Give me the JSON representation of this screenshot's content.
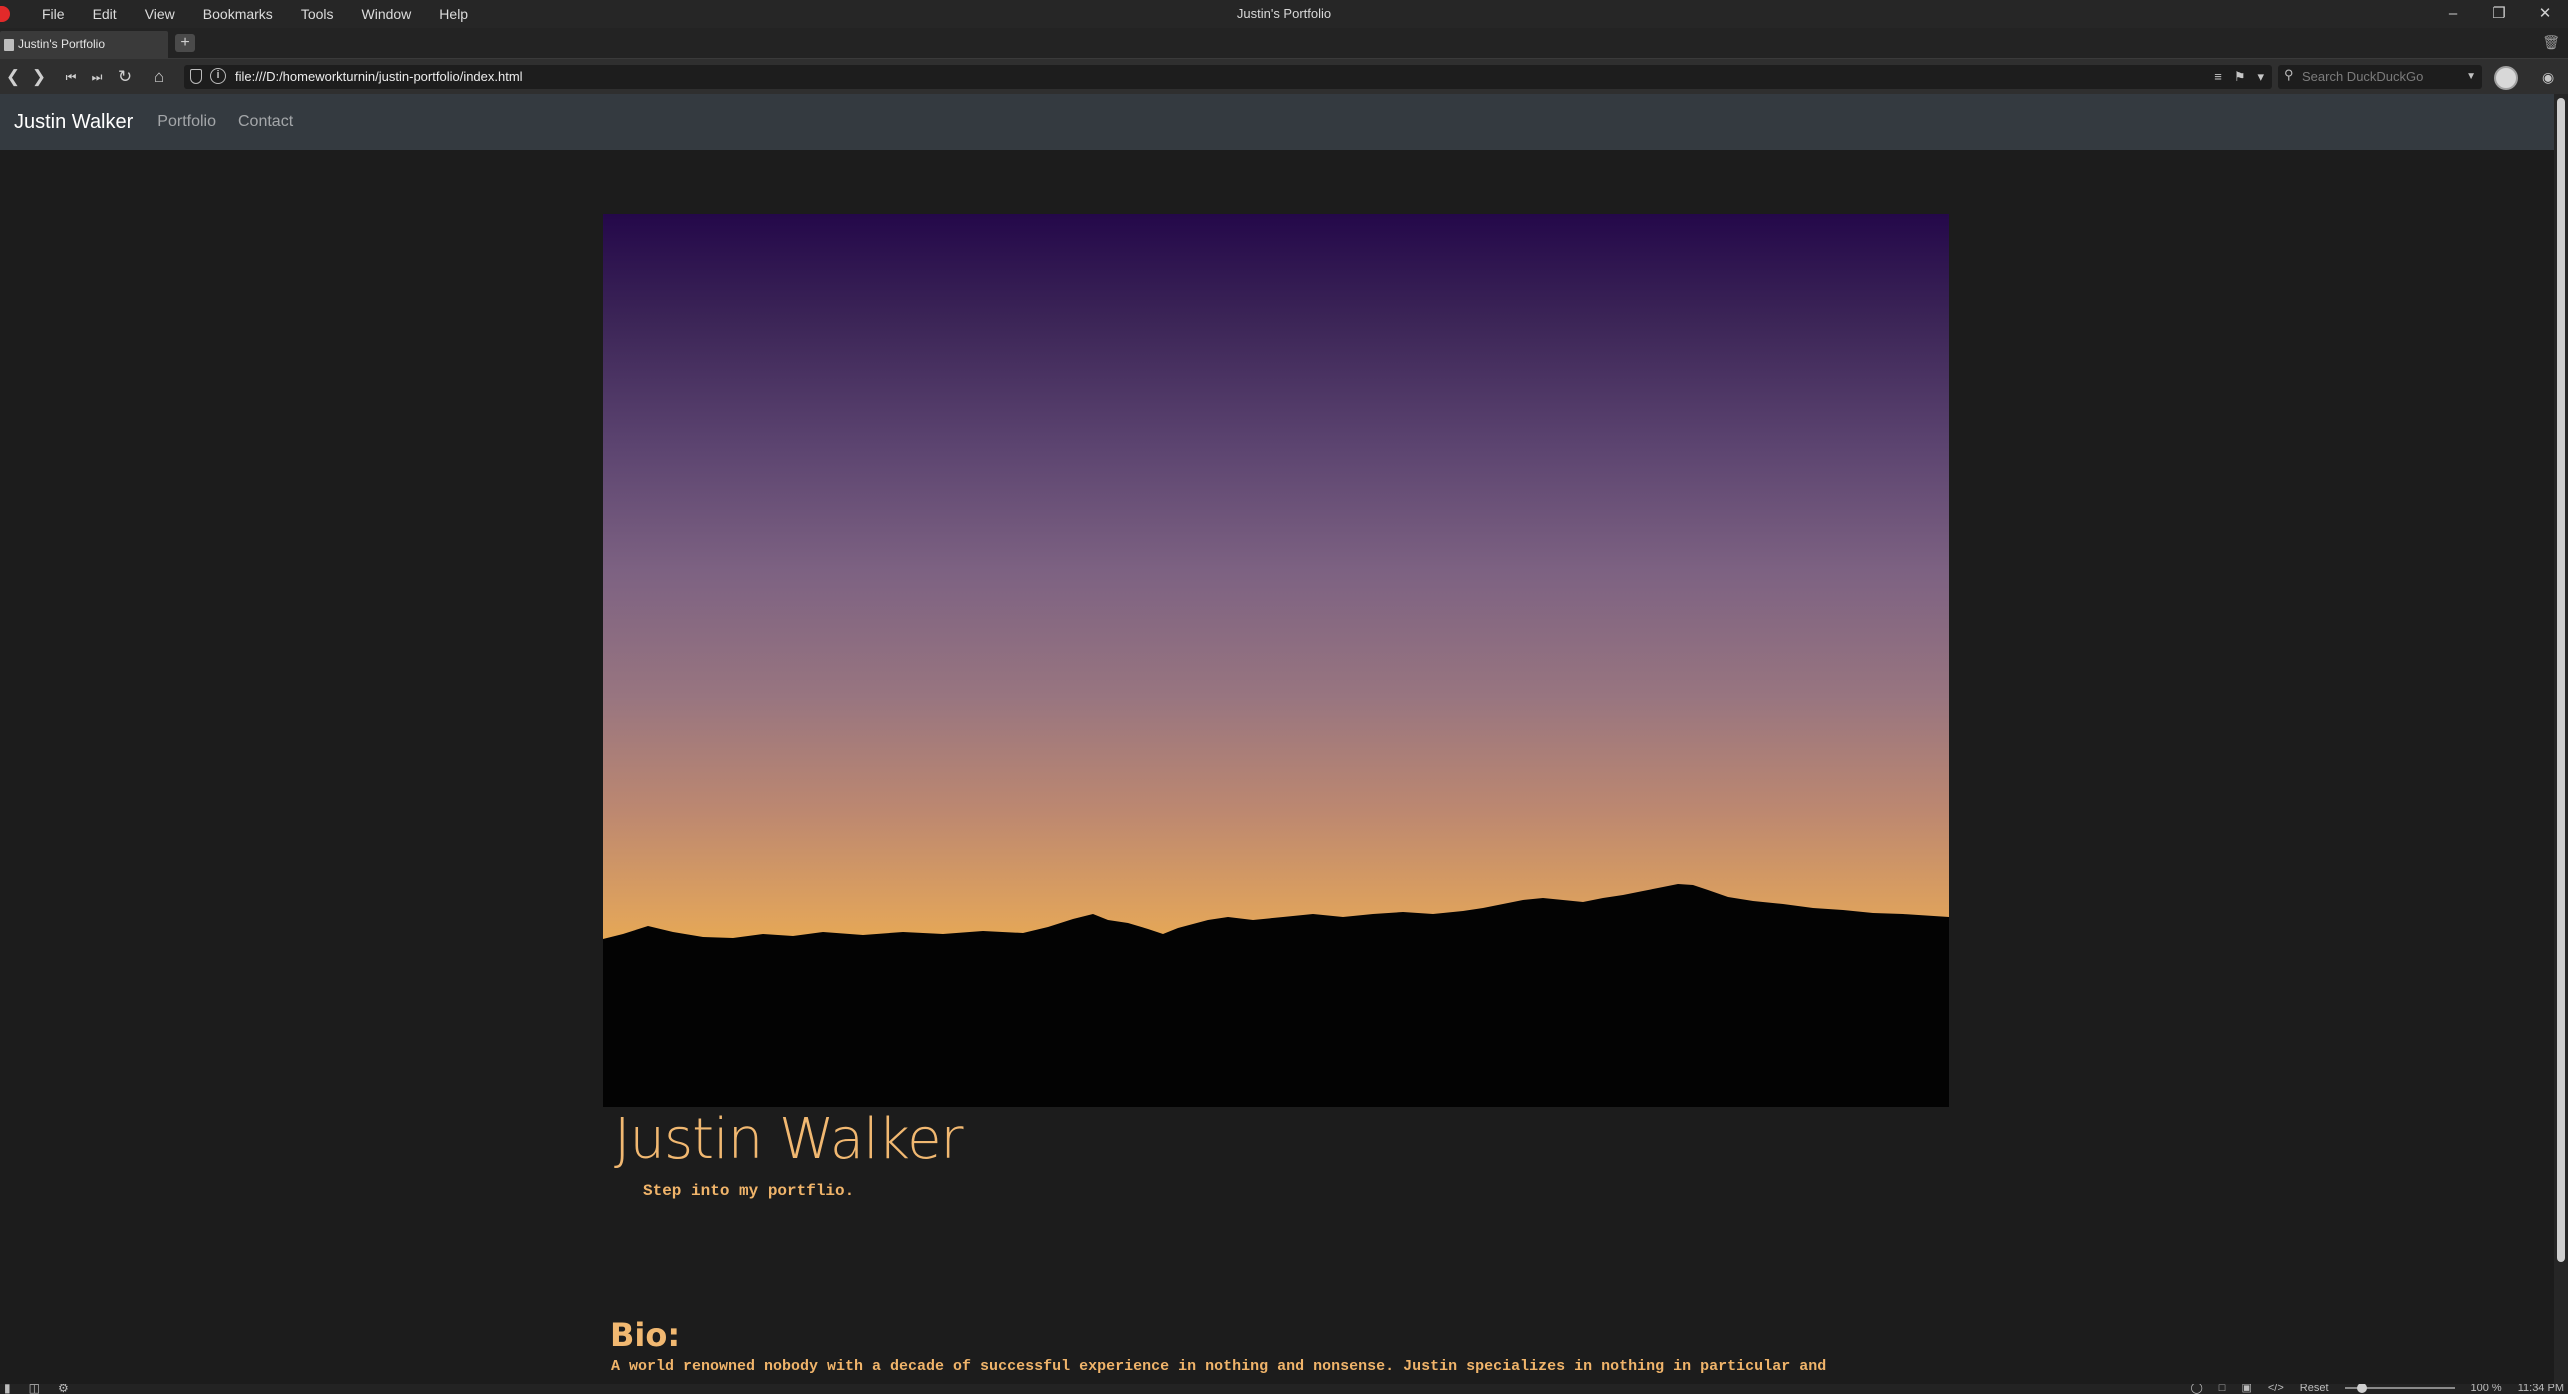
{
  "browser": {
    "window_title": "Justin's Portfolio",
    "menu": [
      "File",
      "Edit",
      "View",
      "Bookmarks",
      "Tools",
      "Window",
      "Help"
    ],
    "tab_title": "Justin's Portfolio",
    "url": "file:///D:/homeworkturnin/justin-portfolio/index.html",
    "search_placeholder": "Search DuckDuckGo",
    "status": {
      "reset_label": "Reset",
      "zoom": "100 %",
      "clock": "11:34 PM"
    }
  },
  "site": {
    "brand": "Justin Walker",
    "nav": [
      "Portfolio",
      "Contact"
    ],
    "hero_title": "Justin Walker",
    "hero_subtitle": "Step into my portflio.",
    "bio_heading": "Bio:",
    "bio_text": "A world renowned nobody with a decade of successful experience in nothing and nonsense. Justin specializes in nothing in particular and"
  },
  "colors": {
    "navbar_bg": "#343a40",
    "page_bg": "#1c1c1c",
    "accent_orange": "#f1b871"
  }
}
